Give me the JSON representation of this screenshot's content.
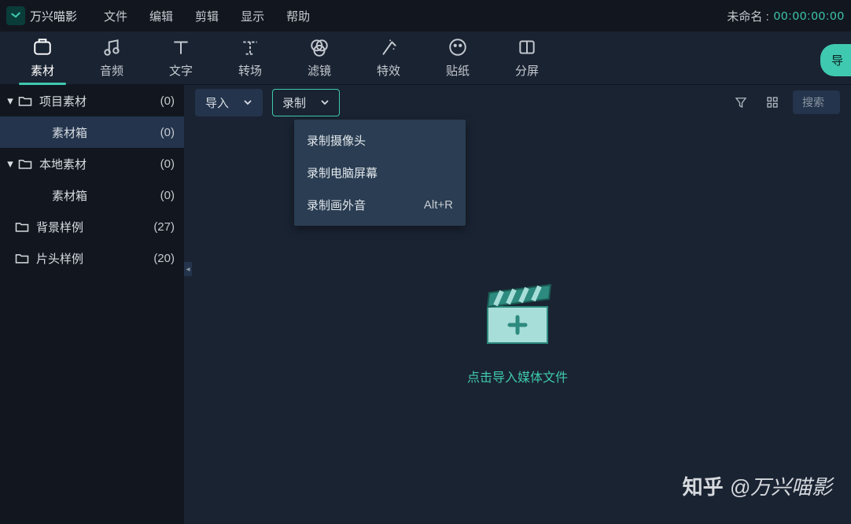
{
  "app": {
    "name": "万兴喵影",
    "menus": [
      "文件",
      "编辑",
      "剪辑",
      "显示",
      "帮助"
    ],
    "project_name": "未命名",
    "timecode": "00:00:00:00"
  },
  "toolbar": {
    "tabs": [
      {
        "label": "素材"
      },
      {
        "label": "音频"
      },
      {
        "label": "文字"
      },
      {
        "label": "转场"
      },
      {
        "label": "滤镜"
      },
      {
        "label": "特效"
      },
      {
        "label": "贴纸"
      },
      {
        "label": "分屏"
      }
    ],
    "export": "导"
  },
  "sidebar": [
    {
      "label": "项目素材",
      "count": "(0)",
      "expandable": true
    },
    {
      "label": "素材箱",
      "count": "(0)",
      "indent": true,
      "selected": true
    },
    {
      "label": "本地素材",
      "count": "(0)",
      "expandable": true
    },
    {
      "label": "素材箱",
      "count": "(0)",
      "indent": true
    },
    {
      "label": "背景样例",
      "count": "(27)",
      "indent": true,
      "folder": true
    },
    {
      "label": "片头样例",
      "count": "(20)",
      "indent": true,
      "folder": true
    }
  ],
  "content": {
    "import_label": "导入",
    "record_label": "录制",
    "search_placeholder": "搜索",
    "menu_items": [
      {
        "label": "录制摄像头",
        "shortcut": ""
      },
      {
        "label": "录制电脑屏幕",
        "shortcut": ""
      },
      {
        "label": "录制画外音",
        "shortcut": "Alt+R"
      }
    ],
    "import_prompt": "点击导入媒体文件"
  },
  "watermark": {
    "site": "知乎",
    "author": "@万兴喵影"
  }
}
